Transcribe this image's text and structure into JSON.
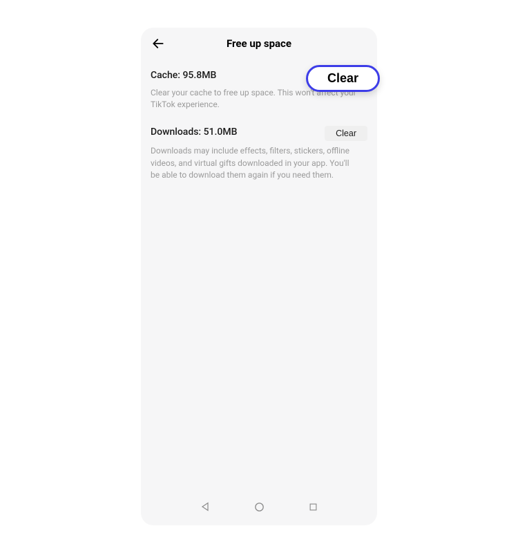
{
  "header": {
    "title": "Free up space"
  },
  "sections": {
    "cache": {
      "title": "Cache: 95.8MB",
      "description": "Clear your cache to free up space. This won't affect your TikTok experience.",
      "button_label": "Clear"
    },
    "downloads": {
      "title": "Downloads: 51.0MB",
      "description": "Downloads may include effects, filters, stickers, offline videos, and virtual gifts downloaded in your app. You'll be able to download them again if you need them.",
      "button_label": "Clear"
    }
  },
  "colors": {
    "highlight_border": "#3d3de8",
    "background": "#f6f6f7"
  }
}
